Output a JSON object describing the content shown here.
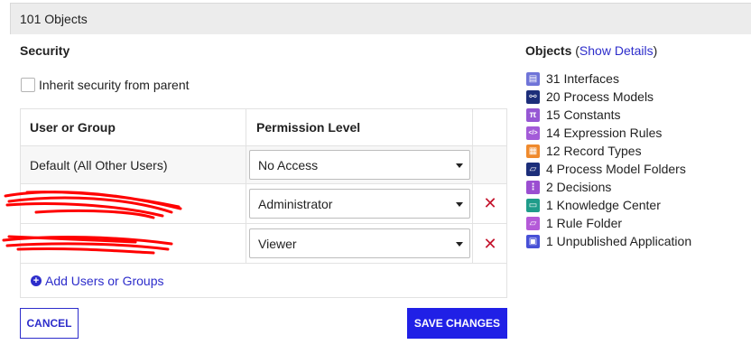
{
  "header": {
    "title": "101 Objects"
  },
  "security": {
    "title": "Security",
    "inherit_label": "Inherit security from parent",
    "columns": [
      "User or Group",
      "Permission Level"
    ],
    "rows": [
      {
        "user": "Default (All Other Users)",
        "permission": "No Access",
        "removable": false
      },
      {
        "user": "",
        "permission": "Administrator",
        "removable": true
      },
      {
        "user": "",
        "permission": "Viewer",
        "removable": true
      }
    ],
    "add_label": "Add Users or Groups"
  },
  "buttons": {
    "cancel": "CANCEL",
    "save": "SAVE CHANGES"
  },
  "objects": {
    "title": "Objects",
    "paren_open": " (",
    "link": "Show Details",
    "paren_close": ")",
    "items": [
      {
        "label": "31 Interfaces",
        "icon": "interface-icon",
        "color": "#6f74d8",
        "glyph": "▤"
      },
      {
        "label": "20 Process Models",
        "icon": "process-model-icon",
        "color": "#1c2e7a",
        "glyph": "⚯"
      },
      {
        "label": "15 Constants",
        "icon": "constant-icon",
        "color": "#9657d4",
        "glyph": "π"
      },
      {
        "label": "14 Expression Rules",
        "icon": "expression-rule-icon",
        "color": "#a35bd8",
        "glyph": "</>"
      },
      {
        "label": "12 Record Types",
        "icon": "record-type-icon",
        "color": "#ef8a2d",
        "glyph": "▦"
      },
      {
        "label": "4 Process Model Folders",
        "icon": "process-model-folder-icon",
        "color": "#1c2e7a",
        "glyph": "▱"
      },
      {
        "label": "2 Decisions",
        "icon": "decision-icon",
        "color": "#9b4ed1",
        "glyph": "⋮"
      },
      {
        "label": "1 Knowledge Center",
        "icon": "knowledge-center-icon",
        "color": "#1f9c8a",
        "glyph": "▭"
      },
      {
        "label": "1 Rule Folder",
        "icon": "rule-folder-icon",
        "color": "#b45ad8",
        "glyph": "▱"
      },
      {
        "label": "1 Unpublished Application",
        "icon": "application-icon",
        "color": "#4750d6",
        "glyph": "▣"
      }
    ]
  },
  "colors": {
    "link": "#2d2dcb",
    "save_button": "#2020e6",
    "remove": "#c4132c",
    "redaction": "#ff0000"
  }
}
